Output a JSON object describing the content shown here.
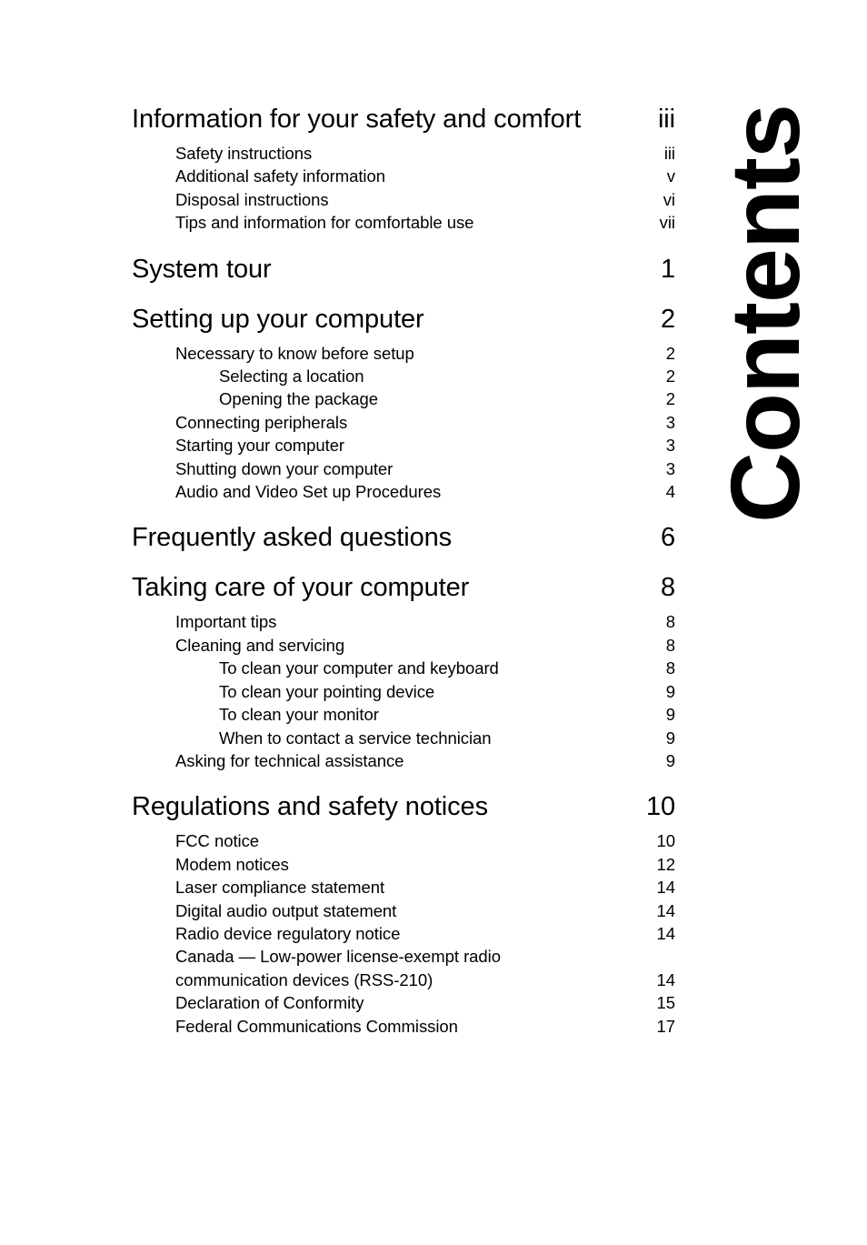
{
  "page": {
    "banner_label": "Contents",
    "background_color": "#ffffff",
    "text_color": "#000000"
  },
  "toc": {
    "sections": [
      {
        "title": "Information for your safety and comfort",
        "page": "iii",
        "entries": [
          {
            "label": "Safety instructions",
            "page": "iii",
            "level": 1
          },
          {
            "label": "Additional safety information",
            "page": "v",
            "level": 1
          },
          {
            "label": "Disposal instructions",
            "page": "vi",
            "level": 1
          },
          {
            "label": "Tips and information for comfortable use",
            "page": "vii",
            "level": 1
          }
        ]
      },
      {
        "title": "System tour",
        "page": "1",
        "entries": []
      },
      {
        "title": "Setting up your computer",
        "page": "2",
        "entries": [
          {
            "label": "Necessary to know before setup",
            "page": "2",
            "level": 1
          },
          {
            "label": "Selecting a location",
            "page": "2",
            "level": 2
          },
          {
            "label": "Opening the package",
            "page": "2",
            "level": 2
          },
          {
            "label": "Connecting peripherals",
            "page": "3",
            "level": 1
          },
          {
            "label": "Starting your computer",
            "page": "3",
            "level": 1
          },
          {
            "label": "Shutting down your computer",
            "page": "3",
            "level": 1
          },
          {
            "label": "Audio and Video Set up Procedures",
            "page": "4",
            "level": 1
          }
        ]
      },
      {
        "title": "Frequently asked questions",
        "page": "6",
        "entries": []
      },
      {
        "title": "Taking care of your computer",
        "page": "8",
        "entries": [
          {
            "label": "Important tips",
            "page": "8",
            "level": 1
          },
          {
            "label": "Cleaning and servicing",
            "page": "8",
            "level": 1
          },
          {
            "label": "To clean your computer and keyboard",
            "page": "8",
            "level": 2
          },
          {
            "label": "To clean your pointing device",
            "page": "9",
            "level": 2
          },
          {
            "label": "To clean your monitor",
            "page": "9",
            "level": 2
          },
          {
            "label": "When to contact a service technician",
            "page": "9",
            "level": 2
          },
          {
            "label": "Asking for technical assistance",
            "page": "9",
            "level": 1
          }
        ]
      },
      {
        "title": "Regulations and safety notices",
        "page": "10",
        "entries": [
          {
            "label": "FCC notice",
            "page": "10",
            "level": 1
          },
          {
            "label": "Modem notices",
            "page": "12",
            "level": 1
          },
          {
            "label": "Laser compliance statement",
            "page": "14",
            "level": 1
          },
          {
            "label": "Digital audio output statement",
            "page": "14",
            "level": 1
          },
          {
            "label": "Radio device regulatory notice",
            "page": "14",
            "level": 1
          },
          {
            "label": "Canada — Low-power license-exempt radio communication devices (RSS-210)",
            "label_line1": "Canada — Low-power license-exempt radio",
            "label_line2": "communication devices (RSS-210)",
            "page": "14",
            "level": 1,
            "wrapped": true
          },
          {
            "label": "Declaration of Conformity",
            "page": "15",
            "level": 1
          },
          {
            "label": "Federal Communications Commission",
            "page": "17",
            "level": 1
          }
        ]
      }
    ]
  }
}
